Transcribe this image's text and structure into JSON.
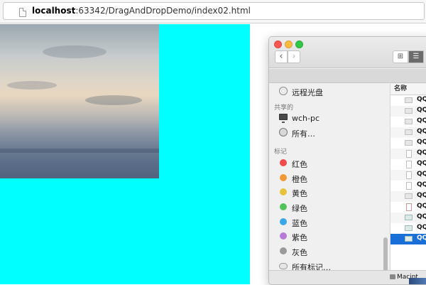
{
  "browser": {
    "url_host": "localhost",
    "url_path": ":63342/DragAndDropDemo/index02.html"
  },
  "finder": {
    "sidebar": {
      "items": [
        {
          "label": "远程光盘",
          "icon": "disc-icon"
        },
        {
          "section": "共享的"
        },
        {
          "label": "wch-pc",
          "icon": "monitor-icon"
        },
        {
          "label": "所有…",
          "icon": "network-globe-icon"
        },
        {
          "section": "标记"
        }
      ],
      "tags": [
        {
          "label": "红色",
          "color": "#f04a4a"
        },
        {
          "label": "橙色",
          "color": "#f29a38"
        },
        {
          "label": "黄色",
          "color": "#e6c33a"
        },
        {
          "label": "绿色",
          "color": "#54c25b"
        },
        {
          "label": "蓝色",
          "color": "#3aa8e8"
        },
        {
          "label": "紫色",
          "color": "#b77ad6"
        },
        {
          "label": "灰色",
          "color": "#9a9a9a"
        }
      ],
      "all_tags": "所有标记…"
    },
    "list": {
      "column_name": "名称",
      "rows": [
        {
          "name": "QQ",
          "icon": "file"
        },
        {
          "name": "QQ",
          "icon": "file"
        },
        {
          "name": "QQ",
          "icon": "file"
        },
        {
          "name": "QQ",
          "icon": "file"
        },
        {
          "name": "QQ",
          "icon": "file"
        },
        {
          "name": "QQ",
          "icon": "doc"
        },
        {
          "name": "QQ",
          "icon": "doc"
        },
        {
          "name": "QQ",
          "icon": "doc"
        },
        {
          "name": "QQ",
          "icon": "doc"
        },
        {
          "name": "QQ",
          "icon": "file"
        },
        {
          "name": "QQ",
          "icon": "pdf"
        },
        {
          "name": "QQ",
          "icon": "img"
        },
        {
          "name": "QQ",
          "icon": "img"
        },
        {
          "name": "QQ",
          "icon": "img",
          "selected": true
        }
      ]
    },
    "status": {
      "disk_label": "Macint"
    }
  }
}
